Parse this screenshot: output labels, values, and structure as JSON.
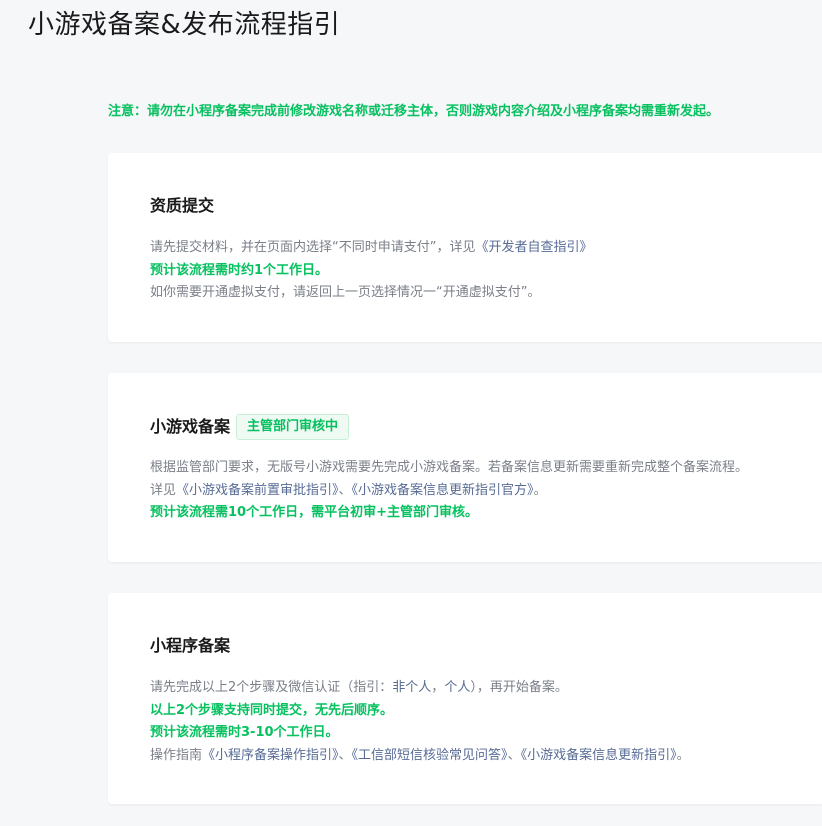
{
  "page": {
    "title": "小游戏备案&发布流程指引"
  },
  "notice": {
    "text": "注意：请勿在小程序备案完成前修改游戏名称或迁移主体，否则游戏内容介绍及小程序备案均需重新发起。"
  },
  "colors": {
    "accent_green": "#07c160",
    "link_blue": "#576b95",
    "text_gray": "#7a7f88"
  },
  "cards": [
    {
      "title": "资质提交",
      "lines": {
        "l1_prefix": "请先提交材料，并在页面内选择“不同时申请支付”，详见",
        "l1_link": "《开发者自查指引》",
        "l2": "预计该流程需时约1个工作日。",
        "l3": "如你需要开通虚拟支付，请返回上一页选择情况一“开通虚拟支付”。"
      }
    },
    {
      "title": "小游戏备案",
      "badge": "主管部门审核中",
      "lines": {
        "l1": "根据监管部门要求，无版号小游戏需要先完成小游戏备案。若备案信息更新需要重新完成整个备案流程。",
        "l2_prefix": "详见",
        "l2_link1": "《小游戏备案前置审批指引》",
        "l2_sep": "、",
        "l2_link2": "《小游戏备案信息更新指引官方》",
        "l2_suffix": "。",
        "l3": "预计该流程需10个工作日，需平台初审+主管部门审核。"
      }
    },
    {
      "title": "小程序备案",
      "lines": {
        "l1_prefix": "请先完成以上2个步骤及微信认证（指引：",
        "l1_link1": "非个人",
        "l1_sep": "，",
        "l1_link2": "个人",
        "l1_suffix": "），再开始备案。",
        "l2": "以上2个步骤支持同时提交，无先后顺序。",
        "l3": "预计该流程需时3-10个工作日。",
        "l4_prefix": "操作指南",
        "l4_link1": "《小程序备案操作指引》",
        "l4_sep1": "、",
        "l4_link2": "《工信部短信核验常见问答》",
        "l4_sep2": "、",
        "l4_link3": "《小游戏备案信息更新指引》",
        "l4_suffix": "。"
      }
    }
  ]
}
